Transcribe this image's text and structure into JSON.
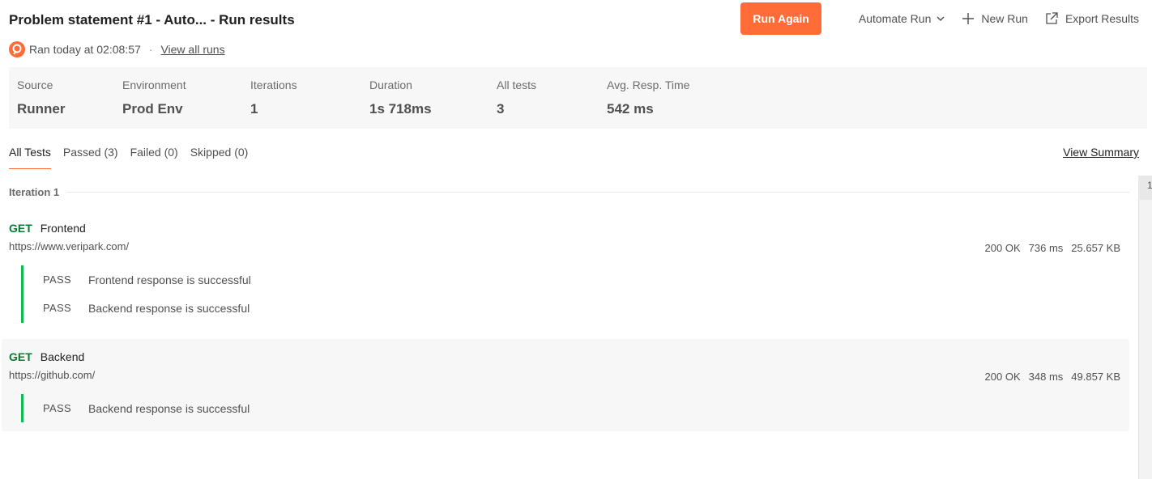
{
  "header": {
    "title": "Problem statement #1 - Auto... - Run results",
    "run_again": "Run Again",
    "automate_run": "Automate Run",
    "new_run": "New Run",
    "export_results": "Export Results"
  },
  "meta": {
    "ran_at": "Ran today at 02:08:57",
    "separator": "·",
    "view_all_runs": "View all runs"
  },
  "summary": [
    {
      "key": "Source",
      "value": "Runner"
    },
    {
      "key": "Environment",
      "value": "Prod Env"
    },
    {
      "key": "Iterations",
      "value": "1"
    },
    {
      "key": "Duration",
      "value": "1s 718ms"
    },
    {
      "key": "All tests",
      "value": "3"
    },
    {
      "key": "Avg. Resp. Time",
      "value": "542 ms"
    }
  ],
  "tabs": [
    "All Tests",
    "Passed (3)",
    "Failed (0)",
    "Skipped (0)"
  ],
  "view_summary": "View Summary",
  "iteration_label": "Iteration 1",
  "scroll_indicator": "1",
  "requests": [
    {
      "method": "GET",
      "name": "Frontend",
      "url": "https://www.veripark.com/",
      "status": "200 OK",
      "time": "736 ms",
      "size": "25.657 KB",
      "tests": [
        {
          "result": "PASS",
          "name": "Frontend response is successful"
        },
        {
          "result": "PASS",
          "name": "Backend response is successful"
        }
      ]
    },
    {
      "method": "GET",
      "name": "Backend",
      "url": "https://github.com/",
      "status": "200 OK",
      "time": "348 ms",
      "size": "49.857 KB",
      "tests": [
        {
          "result": "PASS",
          "name": "Backend response is successful"
        }
      ]
    }
  ],
  "colors": {
    "accent": "#ff6c37",
    "method_get": "#007f31",
    "pass_bar": "#0cbb52"
  }
}
